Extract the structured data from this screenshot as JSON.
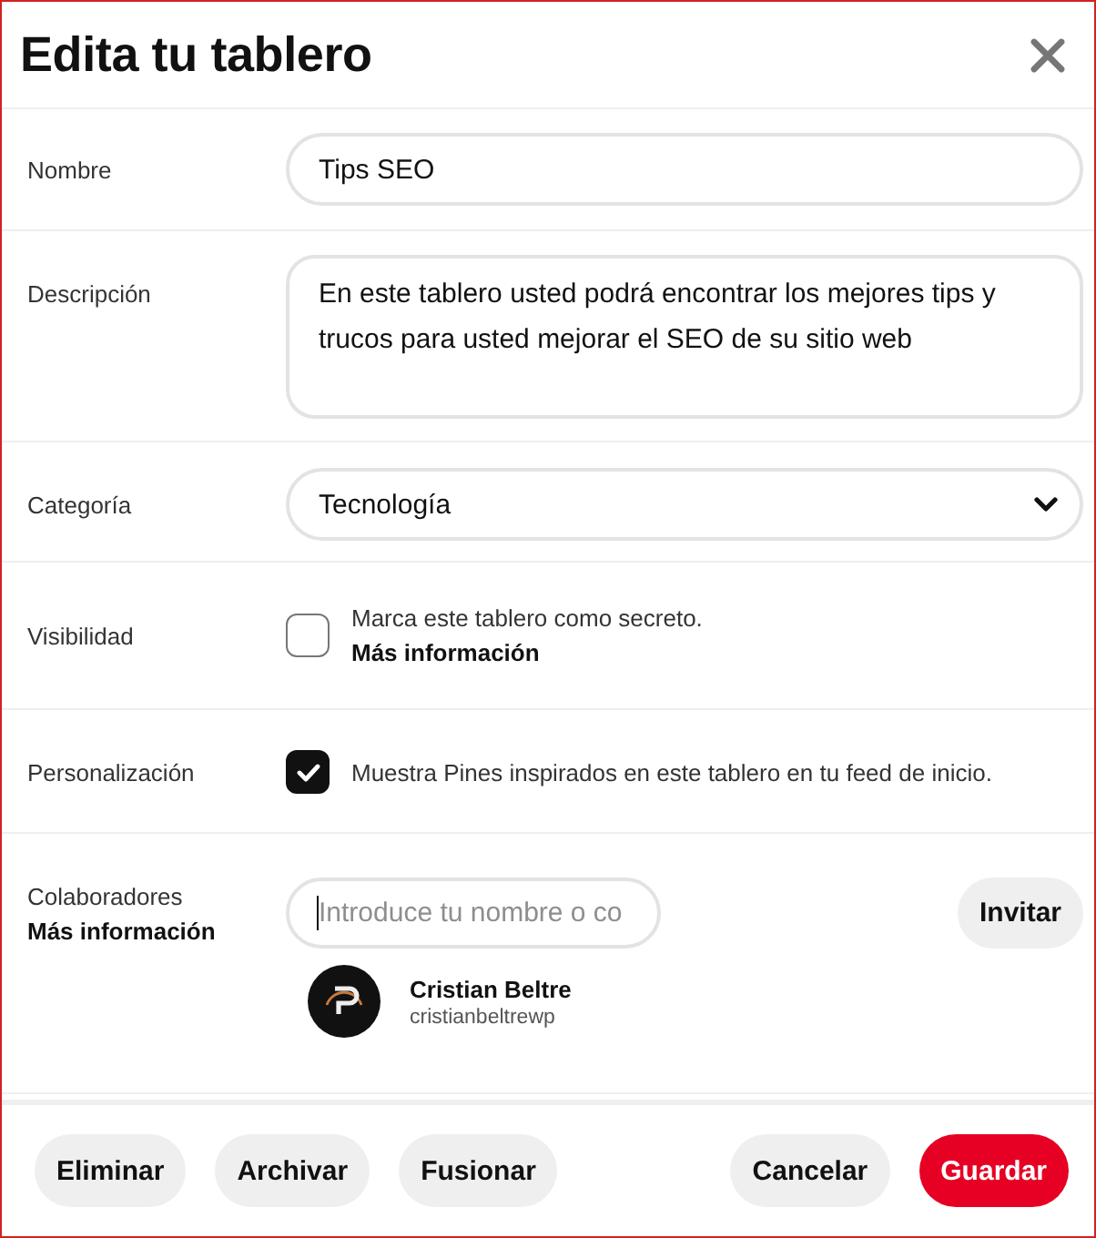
{
  "dialog": {
    "title": "Edita tu tablero"
  },
  "fields": [
    {
      "kind": "text",
      "label": "Nombre",
      "value": "Tips SEO"
    },
    {
      "kind": "textarea",
      "label": "Descripción",
      "value": "En este tablero usted podrá encontrar los mejores tips y trucos para usted mejorar el SEO de su sitio web"
    },
    {
      "kind": "select",
      "label": "Categoría",
      "value": "Tecnología"
    }
  ],
  "checkbox_rows": [
    {
      "label": "Visibilidad",
      "text": "Marca este tablero como secreto.",
      "link": "Más información",
      "checked": false
    },
    {
      "label": "Personalización",
      "text": "Muestra Pines inspirados en este tablero en tu feed de inicio.",
      "checked": true
    }
  ],
  "collaborators": {
    "label": "Colaboradores",
    "link": "Más información",
    "placeholder": "Introduce tu nombre o co",
    "invite_button": "Invitar",
    "members": [
      {
        "name": "Cristian Beltre",
        "username": "cristianbeltrewp"
      }
    ]
  },
  "footer": {
    "left_buttons": [
      {
        "label": "Eliminar",
        "kind": "secondary"
      },
      {
        "label": "Archivar",
        "kind": "secondary"
      },
      {
        "label": "Fusionar",
        "kind": "secondary"
      }
    ],
    "right_buttons": [
      {
        "label": "Cancelar",
        "kind": "secondary"
      },
      {
        "label": "Guardar",
        "kind": "primary"
      }
    ]
  }
}
